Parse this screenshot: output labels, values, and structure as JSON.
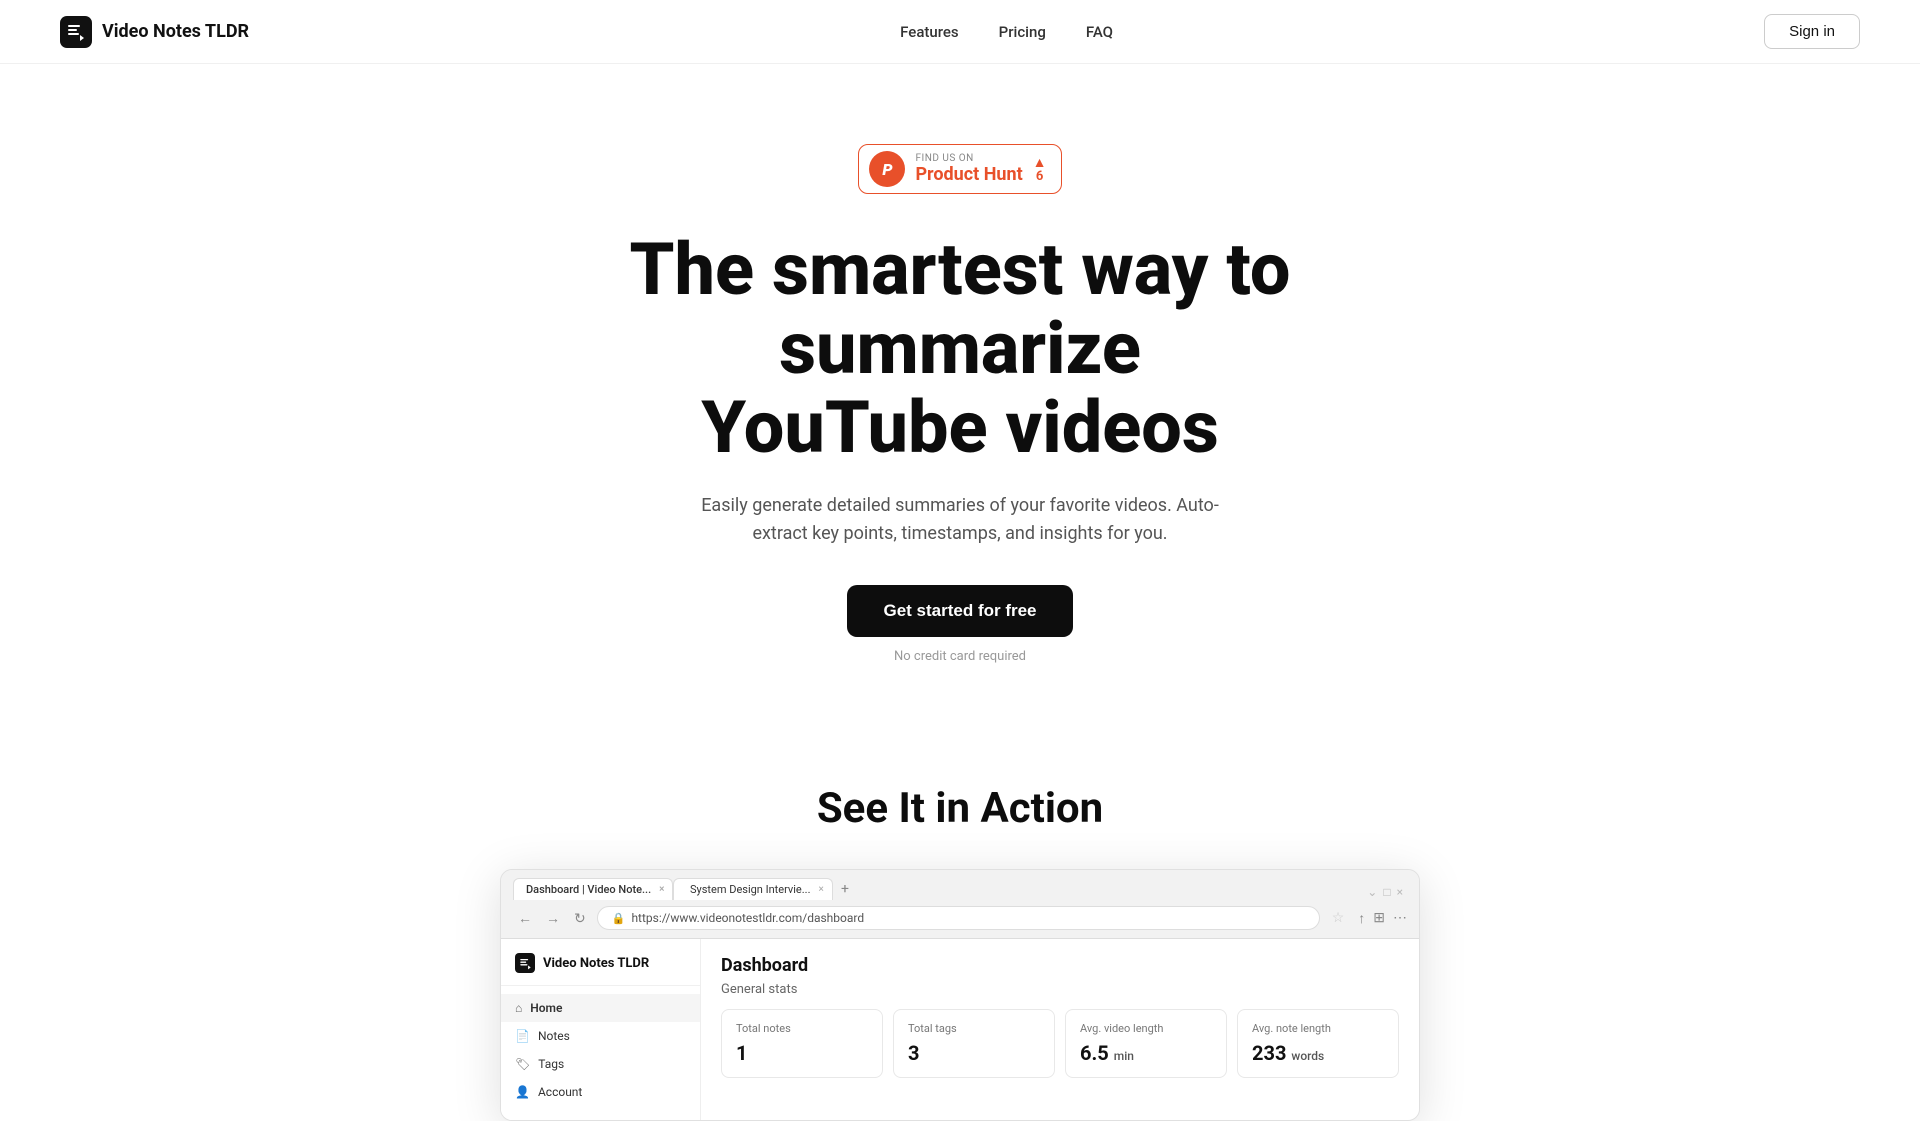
{
  "brand": {
    "name": "Video Notes TLDR",
    "logo_alt": "Video Notes TLDR logo"
  },
  "nav": {
    "links": [
      {
        "label": "Features",
        "href": "#features"
      },
      {
        "label": "Pricing",
        "href": "#pricing"
      },
      {
        "label": "FAQ",
        "href": "#faq"
      }
    ],
    "signin_label": "Sign in"
  },
  "product_hunt": {
    "find_us_on": "FIND US ON",
    "name": "Product Hunt",
    "upvote_arrow": "▲",
    "upvote_count": "6"
  },
  "hero": {
    "title_line1": "The smartest way to summarize",
    "title_line2": "YouTube videos",
    "subtitle": "Easily generate detailed summaries of your favorite videos. Auto-extract key points, timestamps, and insights for you.",
    "cta_label": "Get started for free",
    "no_cc": "No credit card required"
  },
  "action_section": {
    "title": "See It in Action"
  },
  "browser_mockup": {
    "tabs": [
      {
        "label": "Dashboard | Video Note...",
        "active": true,
        "has_dot": false
      },
      {
        "label": "System Design Intervie...",
        "active": false,
        "has_dot": true
      }
    ],
    "url": "https://www.videonotestldr.com/dashboard",
    "app": {
      "brand": "Video Notes TLDR",
      "nav_items": [
        {
          "label": "Home",
          "icon": "🏠",
          "active": true
        },
        {
          "label": "Notes",
          "icon": "📄",
          "active": false
        },
        {
          "label": "Tags",
          "icon": "🏷️",
          "active": false
        },
        {
          "label": "Account",
          "icon": "👤",
          "active": false
        }
      ],
      "dashboard_title": "Dashboard",
      "dashboard_subtitle": "General stats",
      "stats": [
        {
          "label": "Total notes",
          "value": "1",
          "unit": ""
        },
        {
          "label": "Total tags",
          "value": "3",
          "unit": ""
        },
        {
          "label": "Avg. video length",
          "value": "6.5",
          "unit": "min"
        },
        {
          "label": "Avg. note length",
          "value": "233",
          "unit": "words"
        }
      ]
    }
  },
  "colors": {
    "accent_orange": "#e8502a",
    "dark": "#0d0d0d",
    "text_muted": "#555"
  }
}
